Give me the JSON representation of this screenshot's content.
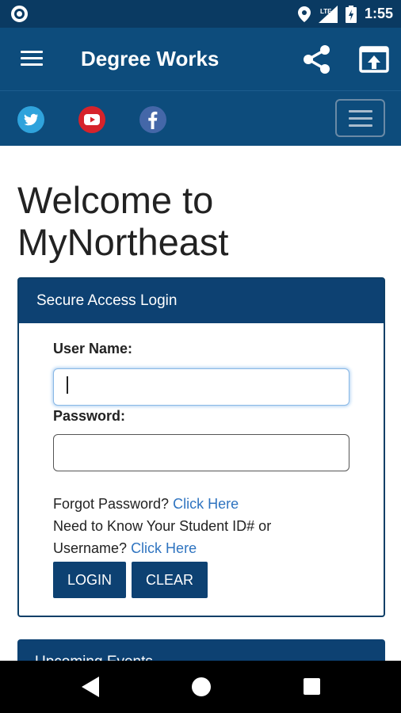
{
  "status_bar": {
    "time": "1:55",
    "network": "LTE"
  },
  "app_bar": {
    "title": "Degree Works"
  },
  "social": {
    "icons": [
      "twitter-icon",
      "youtube-icon",
      "facebook-icon"
    ]
  },
  "page": {
    "welcome_line1": "Welcome to",
    "welcome_line2": "MyNortheast"
  },
  "login": {
    "header": "Secure Access Login",
    "username_label": "User Name:",
    "username_value": "",
    "password_label": "Password:",
    "password_value": "",
    "forgot_text": "Forgot Password?",
    "forgot_link": "Click Here",
    "id_text_line1": "Need to Know Your Student ID# or",
    "id_text_line2": "Username?",
    "id_link": "Click Here",
    "login_button": "LOGIN",
    "clear_button": "CLEAR"
  },
  "events": {
    "header": "Upcoming Events"
  },
  "colors": {
    "primary": "#0d4c7c",
    "card_header": "#0d4172",
    "link": "#2f74c0",
    "status_bar": "#0a3a62"
  }
}
